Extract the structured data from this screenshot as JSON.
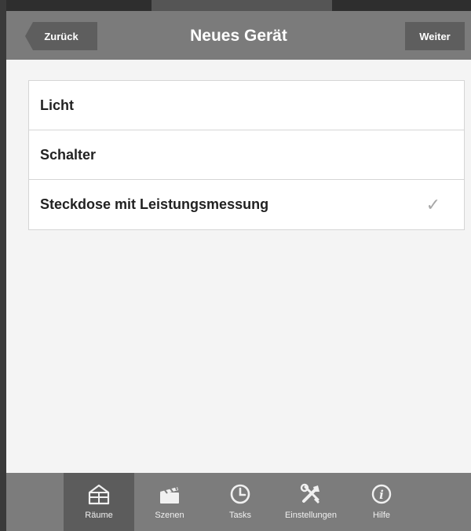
{
  "header": {
    "back_label": "Zurück",
    "title": "Neues Gerät",
    "next_label": "Weiter"
  },
  "device_types": [
    {
      "label": "Licht",
      "selected": false
    },
    {
      "label": "Schalter",
      "selected": false
    },
    {
      "label": "Steckdose mit Leistungsmessung",
      "selected": true
    }
  ],
  "check_glyph": "✓",
  "tabbar": {
    "active": "Räume",
    "tabs": [
      {
        "label": "Räume",
        "icon": "rooms-icon"
      },
      {
        "label": "Szenen",
        "icon": "clapperboard-icon"
      },
      {
        "label": "Tasks",
        "icon": "clock-icon"
      },
      {
        "label": "Einstellungen",
        "icon": "tools-icon"
      },
      {
        "label": "Hilfe",
        "icon": "info-icon"
      }
    ]
  },
  "colors": {
    "header_bg": "#7b7b7b",
    "button_bg": "#5e5e5e",
    "tabbar_bg": "#7c7c7c",
    "tab_active_bg": "#5c5c5c",
    "check": "#a8a8a8"
  }
}
